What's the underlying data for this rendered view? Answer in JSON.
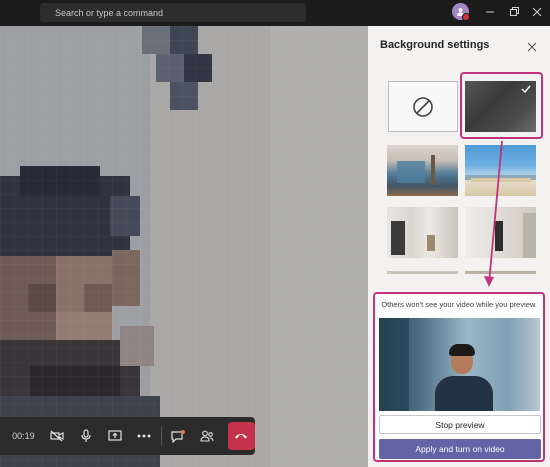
{
  "titlebar": {
    "search_placeholder": "Search or type a command"
  },
  "call": {
    "timer": "00:19",
    "icons": [
      "video-off-icon",
      "microphone-icon",
      "share-screen-icon",
      "more-icon",
      "chat-icon",
      "participants-icon",
      "hang-up-icon"
    ]
  },
  "panel": {
    "title": "Background settings",
    "notice": "Others won't see your video while you preview.",
    "stop_preview_label": "Stop preview",
    "apply_label": "Apply and turn on video",
    "selected_background": "blur"
  },
  "colors": {
    "accent": "#6264a7",
    "highlight": "#c1327f",
    "hangup": "#c4314b",
    "panel_bg": "#f3f2f1"
  }
}
